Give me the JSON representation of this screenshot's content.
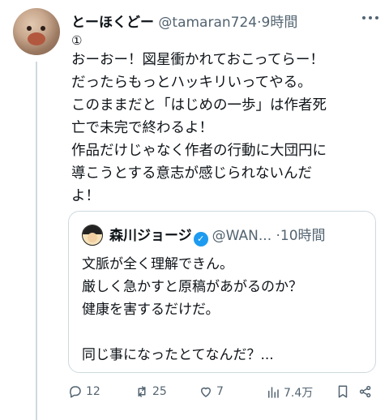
{
  "tweet": {
    "name": "とーほくどー",
    "handle": "@tamaran724",
    "separator": "·",
    "time": "9時間",
    "thread_marker": "①",
    "lines": [
      "おーおー！図星衝かれておこってらー！",
      "だったらもっとハッキリいってやる。",
      "このままだと「はじめの一歩」は作者死",
      "亡で未完で終わるよ！",
      "作品だけじゃなく作者の行動に大団円に",
      "導こうとする意志が感じられないんだ",
      "よ！"
    ]
  },
  "quote": {
    "name": "森川ジョージ",
    "verified_glyph": "✓",
    "handle": "@WAN...",
    "separator": "·",
    "time": "10時間",
    "lines": [
      "文脈が全く理解できん。",
      "厳しく急かすと原稿があがるのか？",
      "健康を害するだけだ。",
      "",
      "同じ事になったとてなんだ？..."
    ]
  },
  "actions": {
    "reply_count": "12",
    "retweet_count": "25",
    "like_count": "7",
    "views_count": "7.4万"
  },
  "icons": [
    "reply-icon",
    "retweet-icon",
    "like-icon",
    "views-icon",
    "bookmark-icon",
    "share-icon",
    "more-icon"
  ]
}
